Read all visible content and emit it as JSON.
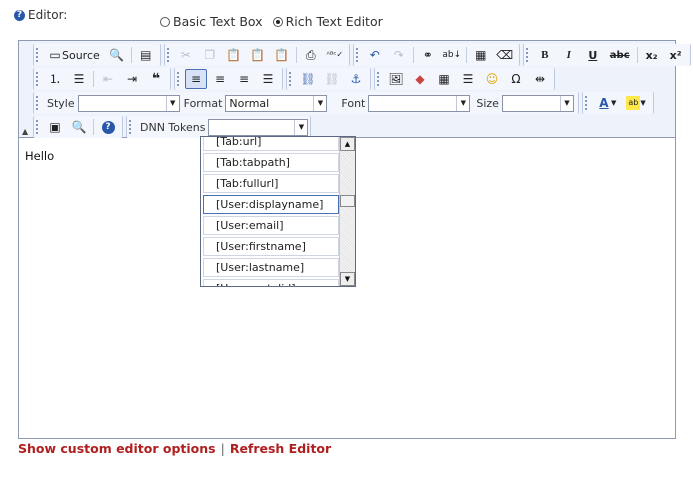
{
  "editor_label": "Editor:",
  "radio": {
    "basic": "Basic Text Box",
    "rich": "Rich Text Editor",
    "selected": "rich"
  },
  "toolbar": {
    "source": "Source",
    "bold": "B",
    "italic": "I",
    "underline": "U",
    "strike": "abc",
    "subscript": "x₂",
    "superscript": "x²",
    "style_label": "Style",
    "style_value": "",
    "format_label": "Format",
    "format_value": "Normal",
    "font_label": "Font",
    "font_value": "",
    "size_label": "Size",
    "size_value": "",
    "tokens_label": "DNN Tokens",
    "tokens_value": ""
  },
  "content_text": "Hello",
  "token_list": [
    "[Tab:url]",
    "[Tab:tabpath]",
    "[Tab:fullurl]",
    "[User:displayname]",
    "[User:email]",
    "[User:firstname]",
    "[User:lastname]",
    "[User:portalid]"
  ],
  "token_selected_index": 3,
  "footer": {
    "custom_options": "Show custom editor options",
    "separator": "|",
    "refresh": "Refresh Editor"
  },
  "colors": {
    "link": "#b01f1f",
    "toolbar_bg": "#eef2fb",
    "border": "#8e9ab4"
  }
}
